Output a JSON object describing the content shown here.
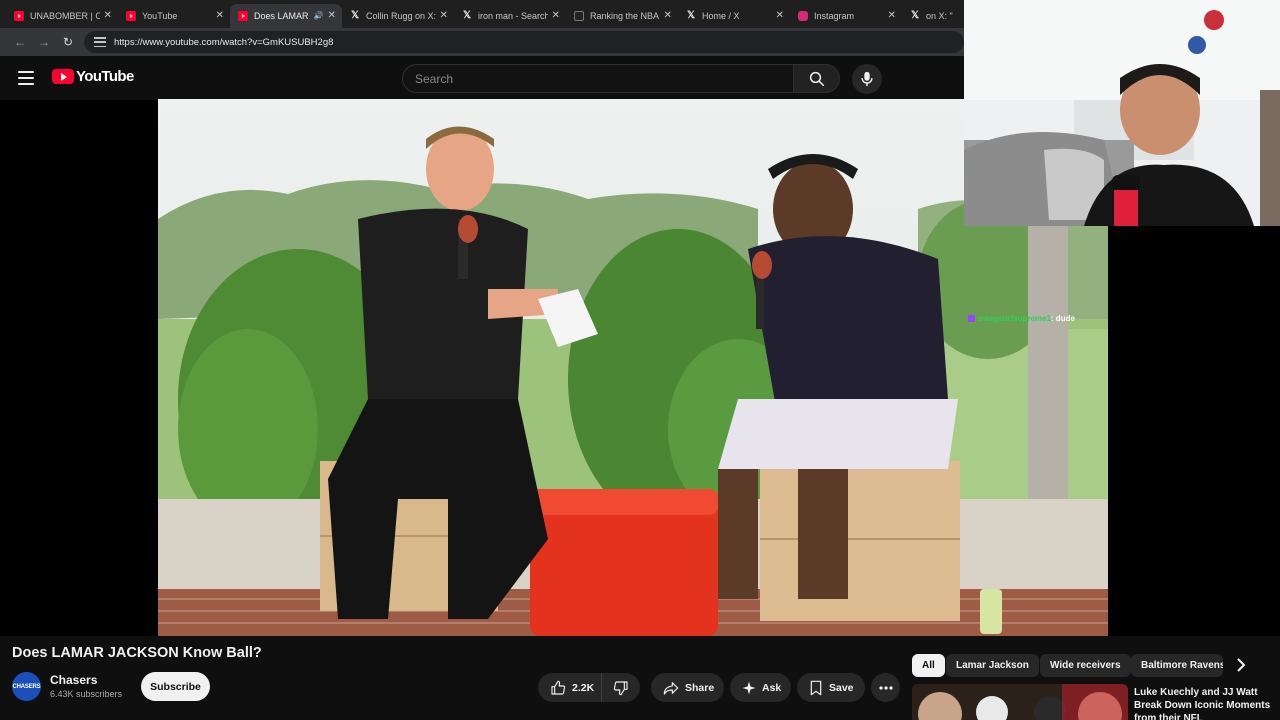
{
  "browser": {
    "tabs": [
      {
        "icon": "youtube-icon",
        "title": "UNABOMBER | Off",
        "active": false
      },
      {
        "icon": "youtube-icon",
        "title": "YouTube",
        "active": false
      },
      {
        "icon": "youtube-icon",
        "title": "Does LAMAR J",
        "active": true
      },
      {
        "icon": "x-icon",
        "title": "Collin Rugg on X:",
        "active": false
      },
      {
        "icon": "x-icon",
        "title": "iron man - Search",
        "active": false
      },
      {
        "icon": "nba-icon",
        "title": "Ranking the NBA",
        "active": false
      },
      {
        "icon": "x-icon",
        "title": "Home / X",
        "active": false
      },
      {
        "icon": "instagram-icon",
        "title": "Instagram",
        "active": false
      },
      {
        "icon": "x-icon",
        "title": "on X: \"",
        "active": false
      }
    ],
    "url": "https://www.youtube.com/watch?v=GmKUSUBH2g8"
  },
  "header": {
    "logo_text": "YouTube",
    "search_placeholder": "Search"
  },
  "stream_overlay": {
    "chat_user": "swagsurfsupreme1",
    "chat_message": ": dude"
  },
  "video": {
    "title": "Does LAMAR JACKSON Know Ball?",
    "channel": {
      "name": "Chasers",
      "avatar_text": "CHASERS",
      "subscribers": "6.43K subscribers",
      "subscribe_label": "Subscribe"
    },
    "actions": {
      "likes": "2.2K",
      "share_label": "Share",
      "ask_label": "Ask",
      "save_label": "Save"
    }
  },
  "chips": [
    "All",
    "Lamar Jackson",
    "Wide receivers",
    "Baltimore Ravens"
  ],
  "recommended": {
    "title": "Luke Kuechly and JJ Watt Break Down Iconic Moments from their NFL"
  },
  "colors": {
    "youtube_red": "#ff0033",
    "background": "#0f0f0f",
    "pill": "#272727"
  }
}
